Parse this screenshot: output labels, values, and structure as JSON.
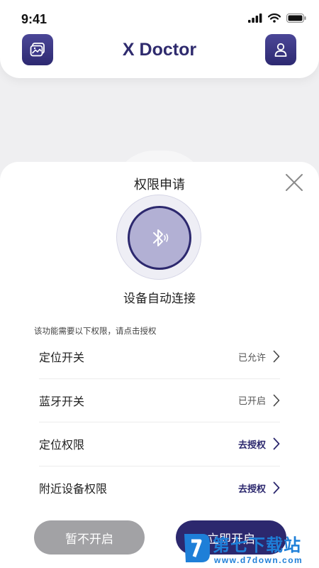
{
  "status_bar": {
    "time": "9:41"
  },
  "header": {
    "title": "X Doctor"
  },
  "sheet": {
    "title": "权限申请",
    "device_label": "设备自动连接",
    "hint": "该功能需要以下权限，请点击授权",
    "permissions": [
      {
        "name": "定位开关",
        "status": "已允许",
        "state": "granted"
      },
      {
        "name": "蓝牙开关",
        "status": "已开启",
        "state": "granted"
      },
      {
        "name": "定位权限",
        "status": "去授权",
        "state": "action"
      },
      {
        "name": "附近设备权限",
        "status": "去授权",
        "state": "action"
      }
    ],
    "cancel_label": "暂不开启",
    "confirm_label": "立即开启"
  },
  "watermark": {
    "brand": "第七下载站",
    "url": "www.d7down.com"
  },
  "colors": {
    "primary": "#2c286e",
    "button_grey": "#a2a2a5",
    "bt_circle": "#b2b0d4",
    "watermark_blue": "#1e7fd8"
  },
  "icons": {
    "left_header": "gallery-icon",
    "right_header": "user-icon",
    "close": "close-icon",
    "center": "bluetooth-icon",
    "row": "chevron-right-icon"
  }
}
